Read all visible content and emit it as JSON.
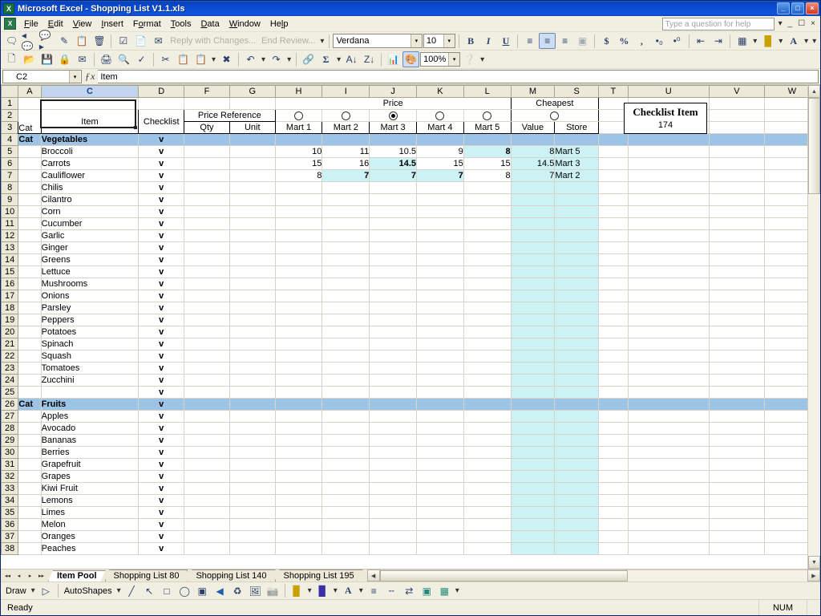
{
  "window": {
    "title": "Microsoft Excel - Shopping List V1.1.xls",
    "app_icon": "excel-icon",
    "minimize": "_",
    "maximize": "□",
    "close": "×"
  },
  "menubar": {
    "items": [
      "File",
      "Edit",
      "View",
      "Insert",
      "Format",
      "Tools",
      "Data",
      "Window",
      "Help"
    ],
    "ask_placeholder": "Type a question for help",
    "doc_minimize": "_",
    "doc_restore": "▣",
    "doc_close": "×"
  },
  "toolbars": {
    "reviewing": {
      "icons": [
        "new-comment-icon",
        "previous-comment-icon",
        "next-comment-icon",
        "highlight-changes-icon",
        "insert-comment-icon",
        "delete-comment-icon",
        "show-ink-icon",
        "reply-with-changes-icon",
        "end-review-icon"
      ],
      "reply_label": "Reply with Changes...",
      "end_label": "End Review..."
    },
    "standard": {
      "icons": [
        "new-icon",
        "open-icon",
        "save-icon",
        "permission-icon",
        "email-icon",
        "print-icon",
        "print-preview-icon",
        "spelling-icon",
        "cut-icon",
        "copy-icon",
        "paste-icon",
        "format-painter-icon",
        "undo-icon",
        "redo-icon",
        "insert-hyperlink-icon",
        "autosum-icon",
        "sort-asc-icon",
        "sort-desc-icon",
        "chart-wizard-icon",
        "drawing-icon"
      ],
      "zoom_value": "100%",
      "help_icon": "help-icon"
    },
    "formatting": {
      "font_value": "Verdana",
      "size_value": "10",
      "bold": "B",
      "italic": "I",
      "underline": "U",
      "align_left": "align-left-icon",
      "align_center": "align-center-icon",
      "align_right": "align-right-icon",
      "merge_center": "merge-center-icon",
      "currency": "$",
      "percent": "%",
      "comma": ",",
      "inc_decimal": "increase-decimal-icon",
      "dec_decimal": "decrease-decimal-icon",
      "dec_indent": "decrease-indent-icon",
      "inc_indent": "increase-indent-icon",
      "borders": "borders-icon",
      "fill_color": "fill-color-icon",
      "font_color": "A"
    }
  },
  "formula_bar": {
    "name_box": "C2",
    "fx_label": "fx",
    "content": "Item"
  },
  "sheet": {
    "columns": [
      "A",
      "C",
      "D",
      "F",
      "G",
      "H",
      "I",
      "J",
      "K",
      "L",
      "M",
      "S",
      "T",
      "U",
      "V",
      "W"
    ],
    "selected_column": "C",
    "row_numbers": [
      "1",
      "2",
      "3",
      "4",
      "5",
      "6",
      "7",
      "8",
      "9",
      "10",
      "11",
      "12",
      "13",
      "14",
      "15",
      "16",
      "17",
      "18",
      "19",
      "20",
      "21",
      "22",
      "23",
      "24",
      "25",
      "26",
      "27",
      "28",
      "29",
      "30",
      "31",
      "32",
      "33",
      "34",
      "35",
      "36",
      "37",
      "38"
    ],
    "headers": {
      "price_group": "Price",
      "cheapest_group": "Cheapest",
      "cat": "Cat",
      "item": "Item",
      "checklist": "Checklist",
      "price_reference": "Price Reference",
      "qty": "Qty",
      "unit": "Unit",
      "marts": [
        "Mart 1",
        "Mart 2",
        "Mart 3",
        "Mart 4",
        "Mart 5"
      ],
      "mart_radio_selected_index": 2,
      "cheapest_radio_selected": false,
      "value": "Value",
      "store": "Store"
    },
    "check_mark": "v",
    "rows": [
      {
        "row": 4,
        "cat": "Cat",
        "item": "Vegetables",
        "check": "v",
        "category": true
      },
      {
        "row": 5,
        "cat": "",
        "item": "Broccoli",
        "check": "v",
        "qty": "",
        "unit": "",
        "marts": [
          "10",
          "11",
          "10.5",
          "9",
          "8"
        ],
        "bold_index": 4,
        "cheap_value": "8",
        "cheap_store": "Mart 5"
      },
      {
        "row": 6,
        "cat": "",
        "item": "Carrots",
        "check": "v",
        "qty": "",
        "unit": "",
        "marts": [
          "15",
          "16",
          "14.5",
          "15",
          "15"
        ],
        "bold_index": 2,
        "cheap_value": "14.5",
        "cheap_store": "Mart 3"
      },
      {
        "row": 7,
        "cat": "",
        "item": "Cauliflower",
        "check": "v",
        "qty": "",
        "unit": "",
        "marts": [
          "8",
          "7",
          "7",
          "7",
          "8"
        ],
        "bold_index": 1,
        "bold_index2": 2,
        "bold_index3": 3,
        "cheap_value": "7",
        "cheap_store": "Mart 2"
      },
      {
        "row": 8,
        "cat": "",
        "item": "Chilis",
        "check": "v"
      },
      {
        "row": 9,
        "cat": "",
        "item": "Cilantro",
        "check": "v"
      },
      {
        "row": 10,
        "cat": "",
        "item": "Corn",
        "check": "v"
      },
      {
        "row": 11,
        "cat": "",
        "item": "Cucumber",
        "check": "v"
      },
      {
        "row": 12,
        "cat": "",
        "item": "Garlic",
        "check": "v"
      },
      {
        "row": 13,
        "cat": "",
        "item": "Ginger",
        "check": "v"
      },
      {
        "row": 14,
        "cat": "",
        "item": "Greens",
        "check": "v"
      },
      {
        "row": 15,
        "cat": "",
        "item": "Lettuce",
        "check": "v"
      },
      {
        "row": 16,
        "cat": "",
        "item": "Mushrooms",
        "check": "v"
      },
      {
        "row": 17,
        "cat": "",
        "item": "Onions",
        "check": "v"
      },
      {
        "row": 18,
        "cat": "",
        "item": "Parsley",
        "check": "v"
      },
      {
        "row": 19,
        "cat": "",
        "item": "Peppers",
        "check": "v"
      },
      {
        "row": 20,
        "cat": "",
        "item": "Potatoes",
        "check": "v"
      },
      {
        "row": 21,
        "cat": "",
        "item": "Spinach",
        "check": "v"
      },
      {
        "row": 22,
        "cat": "",
        "item": "Squash",
        "check": "v"
      },
      {
        "row": 23,
        "cat": "",
        "item": "Tomatoes",
        "check": "v"
      },
      {
        "row": 24,
        "cat": "",
        "item": "Zucchini",
        "check": "v"
      },
      {
        "row": 25,
        "cat": "",
        "item": "",
        "check": "v"
      },
      {
        "row": 26,
        "cat": "Cat",
        "item": "Fruits",
        "check": "v",
        "category": true
      },
      {
        "row": 27,
        "cat": "",
        "item": "Apples",
        "check": "v"
      },
      {
        "row": 28,
        "cat": "",
        "item": "Avocado",
        "check": "v"
      },
      {
        "row": 29,
        "cat": "",
        "item": "Bananas",
        "check": "v"
      },
      {
        "row": 30,
        "cat": "",
        "item": "Berries",
        "check": "v"
      },
      {
        "row": 31,
        "cat": "",
        "item": "Grapefruit",
        "check": "v"
      },
      {
        "row": 32,
        "cat": "",
        "item": "Grapes",
        "check": "v"
      },
      {
        "row": 33,
        "cat": "",
        "item": "Kiwi Fruit",
        "check": "v"
      },
      {
        "row": 34,
        "cat": "",
        "item": "Lemons",
        "check": "v"
      },
      {
        "row": 35,
        "cat": "",
        "item": "Limes",
        "check": "v"
      },
      {
        "row": 36,
        "cat": "",
        "item": "Melon",
        "check": "v"
      },
      {
        "row": 37,
        "cat": "",
        "item": "Oranges",
        "check": "v"
      },
      {
        "row": 38,
        "cat": "",
        "item": "Peaches",
        "check": "v"
      }
    ]
  },
  "checklist_box": {
    "title": "Checklist Item",
    "count": "174"
  },
  "sheet_tabs": {
    "first": "◀◀",
    "prev": "◀",
    "next": "▶",
    "last": "▶▶",
    "tabs": [
      {
        "label": "Item Pool",
        "active": true
      },
      {
        "label": "Shopping List 80",
        "active": false
      },
      {
        "label": "Shopping List 140",
        "active": false
      },
      {
        "label": "Shopping List 195",
        "active": false
      }
    ]
  },
  "drawing_toolbar": {
    "draw_label": "Draw",
    "autoshapes_label": "AutoShapes",
    "icons": [
      "select-objects-icon",
      "line-icon",
      "arrow-icon",
      "rectangle-icon",
      "oval-icon",
      "text-box-icon",
      "wordart-icon",
      "diagram-icon",
      "clip-art-icon",
      "picture-icon",
      "fill-color-icon",
      "line-color-icon",
      "font-color-icon",
      "line-style-icon",
      "dash-style-icon",
      "arrow-style-icon",
      "shadow-style-icon",
      "3d-style-icon"
    ],
    "font_color_letter": "A"
  },
  "status_bar": {
    "status": "Ready",
    "num_lock": "NUM"
  },
  "colors": {
    "title_bar": "#0a4ad0",
    "category_row": "#9dc3e6",
    "cheapest_fill": "#ccf2f5",
    "toolbar_bg": "#f1efe2",
    "selected_header": "#c3d4ee"
  }
}
